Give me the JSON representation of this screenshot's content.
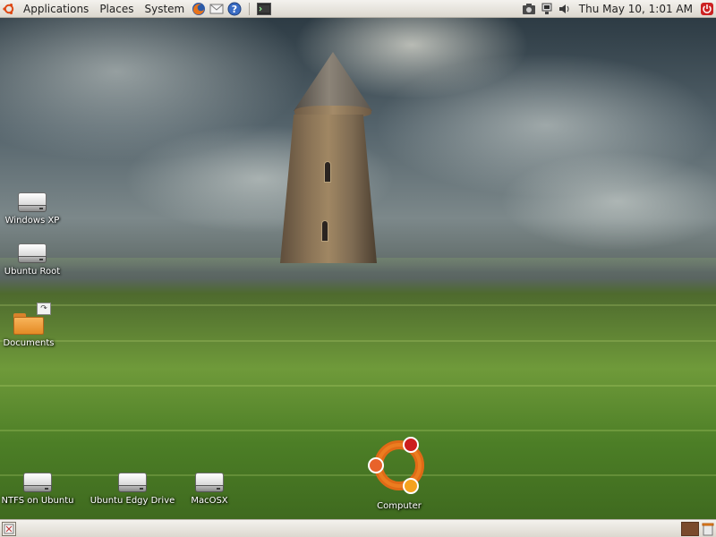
{
  "top_panel": {
    "menus": {
      "applications": "Applications",
      "places": "Places",
      "system": "System"
    },
    "launchers": [
      "firefox-icon",
      "mail-icon",
      "help-icon",
      "terminal-icon"
    ],
    "tray": [
      "screenshot-icon",
      "network-icon",
      "volume-icon"
    ],
    "clock": "Thu May 10,  1:01 AM",
    "power_icon": "power-icon"
  },
  "desktop": {
    "icons": {
      "windows_xp": "Windows XP",
      "ubuntu_root": "Ubuntu Root",
      "documents": "Documents",
      "ntfs_on_ubuntu": "NTFS on Ubuntu",
      "ubuntu_edgy_drive": "Ubuntu Edgy Drive",
      "macosx": "MacOSX",
      "computer": "Computer"
    }
  },
  "bottom_panel": {
    "show_desktop_icon": "show-desktop-icon",
    "workspace_color": "#7a4a2c",
    "trash_icon": "trash-icon"
  },
  "colors": {
    "panel": "#dcd8cf",
    "ubuntu_orange": "#dd4814"
  }
}
